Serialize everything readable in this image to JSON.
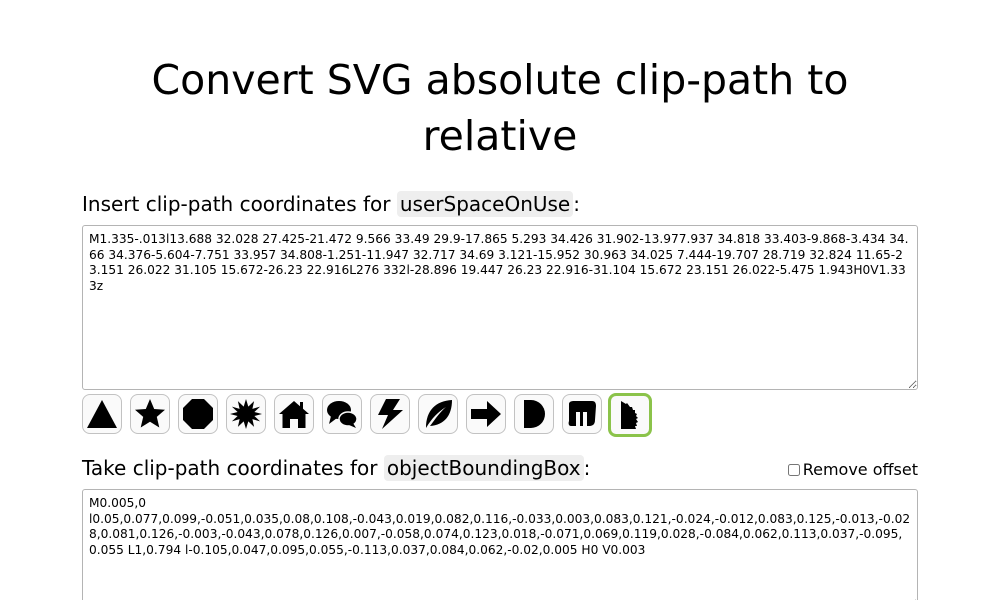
{
  "title": "Convert SVG absolute clip-path to relative",
  "input_section": {
    "label_prefix": "Insert clip-path coordinates for ",
    "label_code": "userSpaceOnUse",
    "label_suffix": ":",
    "value": "M1.335-.013l13.688 32.028 27.425-21.472 9.566 33.49 29.9-17.865 5.293 34.426 31.902-13.977.937 34.818 33.403-9.868-3.434 34.66 34.376-5.604-7.751 33.957 34.808-1.251-11.947 32.717 34.69 3.121-15.952 30.963 34.025 7.444-19.707 28.719 32.824 11.65-23.151 26.022 31.105 15.672-26.23 22.916L276 332l-28.896 19.447 26.23 22.916-31.104 15.672 23.151 26.022-5.475 1.943H0V1.333z"
  },
  "shape_presets": [
    {
      "icon": "triangle-icon"
    },
    {
      "icon": "star-icon"
    },
    {
      "icon": "octagon-icon"
    },
    {
      "icon": "starburst-icon"
    },
    {
      "icon": "house-icon"
    },
    {
      "icon": "speech-bubbles-icon"
    },
    {
      "icon": "lightning-icon"
    },
    {
      "icon": "leaf-icon"
    },
    {
      "icon": "arrow-right-icon"
    },
    {
      "icon": "half-circle-icon"
    },
    {
      "icon": "blob-icon"
    },
    {
      "icon": "serrated-edge-icon",
      "selected": true
    }
  ],
  "output_section": {
    "label_prefix": "Take clip-path coordinates for ",
    "label_code": "objectBoundingBox",
    "label_suffix": ":",
    "remove_offset_label": "Remove offset",
    "remove_offset_checked": false,
    "value": "M0.005,0\nl0.05,0.077,0.099,-0.051,0.035,0.08,0.108,-0.043,0.019,0.082,0.116,-0.033,0.003,0.083,0.121,-0.024,-0.012,0.083,0.125,-0.013,-0.028,0.081,0.126,-0.003,-0.043,0.078,0.126,0.007,-0.058,0.074,0.123,0.018,-0.071,0.069,0.119,0.028,-0.084,0.062,0.113,0.037,-0.095,0.055 L1,0.794 l-0.105,0.047,0.095,0.055,-0.113,0.037,0.084,0.062,-0.02,0.005 H0 V0.003"
  },
  "accent_color": "#8bc34a"
}
